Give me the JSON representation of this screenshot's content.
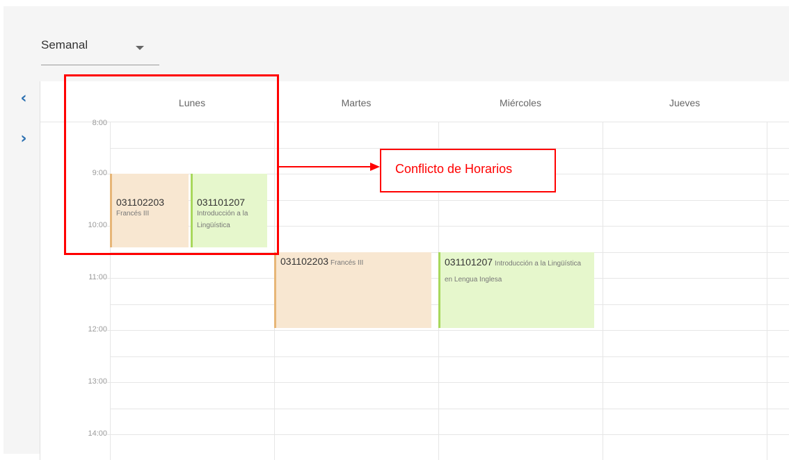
{
  "toolbar": {
    "view_label": "Semanal",
    "prev_symbol": "‹",
    "next_symbol": "›"
  },
  "days": [
    "Lunes",
    "Martes",
    "Miércoles",
    "Jueves"
  ],
  "times": [
    "8:00",
    "9:00",
    "10:00",
    "11:00",
    "12:00",
    "13:00",
    "14:00"
  ],
  "events": {
    "lunes_frances": {
      "code": "031102203",
      "name": "Francés III"
    },
    "lunes_introduccion": {
      "code": "031101207",
      "name": "Introducción a la Lingüística"
    },
    "martes_frances": {
      "code": "031102203",
      "name": "Francés III"
    },
    "miercoles_introduccion": {
      "code": "031101207",
      "name": "Introducción a la Lingüística en Lengua Inglesa"
    }
  },
  "annotation": {
    "text": "Conflicto de Horarios"
  },
  "colors": {
    "accent": "#2a6fb0",
    "event_orange_bg": "#f8e7d1",
    "event_orange_border": "#e7b677",
    "event_green_bg": "#e6f7cc",
    "event_green_border": "#a8d85c",
    "annotation_red": "#ff0000"
  },
  "icons": {
    "prev": "chevron-left-icon",
    "next": "chevron-right-icon",
    "dropdown": "caret-down-icon"
  }
}
